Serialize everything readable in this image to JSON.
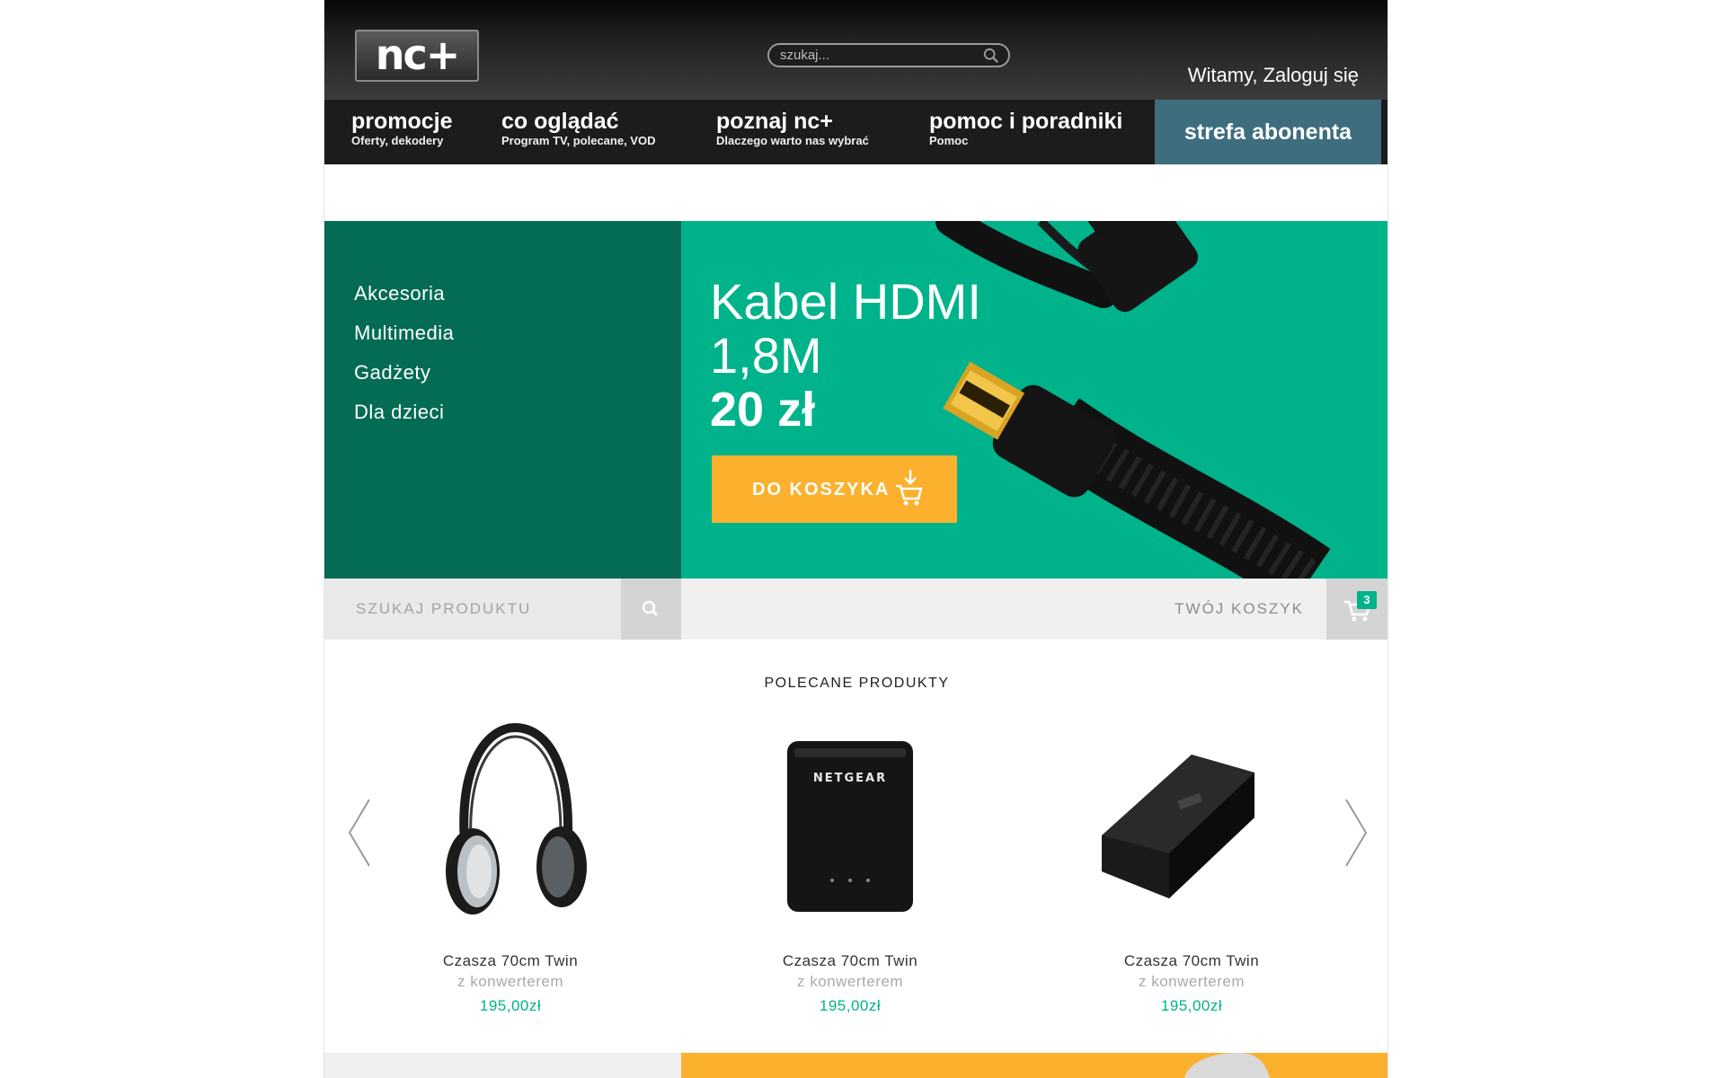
{
  "header": {
    "logo_text": "nc+",
    "search_placeholder": "szukaj...",
    "greeting": "Witamy, Zaloguj się"
  },
  "nav": {
    "items": [
      {
        "title": "promocje",
        "subtitle": "Oferty, dekodery"
      },
      {
        "title": "co oglądać",
        "subtitle": "Program TV, polecane, VOD"
      },
      {
        "title": "poznaj nc+",
        "subtitle": "Dlaczego warto nas wybrać"
      },
      {
        "title": "pomoc i poradniki",
        "subtitle": "Pomoc"
      }
    ],
    "strefa": "strefa abonenta"
  },
  "categories": [
    "Akcesoria",
    "Multimedia",
    "Gadżety",
    "Dla dzieci"
  ],
  "hero": {
    "title_line1": "Kabel HDMI",
    "title_line2": "1,8M",
    "price": "20 zł",
    "cart_button": "DO KOSZYKA"
  },
  "product_search": {
    "placeholder": "SZUKAJ PRODUKTU"
  },
  "cart": {
    "label": "TWÓJ KOSZYK",
    "count": "3"
  },
  "recommended": {
    "title": "POLECANE PRODUKTY",
    "products": [
      {
        "name": "Czasza 70cm Twin",
        "sub": "z konwerterem",
        "price": "195,00zł",
        "image": "headphones"
      },
      {
        "name": "Czasza 70cm Twin",
        "sub": "z konwerterem",
        "price": "195,00zł",
        "image": "router",
        "brand": "NETGEAR"
      },
      {
        "name": "Czasza 70cm Twin",
        "sub": "z konwerterem",
        "price": "195,00zł",
        "image": "external-drive"
      }
    ]
  },
  "colors": {
    "dark_green": "#046b55",
    "accent_green": "#00b38b",
    "orange": "#fbb12e",
    "strefa_blue": "#3e6d7d"
  }
}
